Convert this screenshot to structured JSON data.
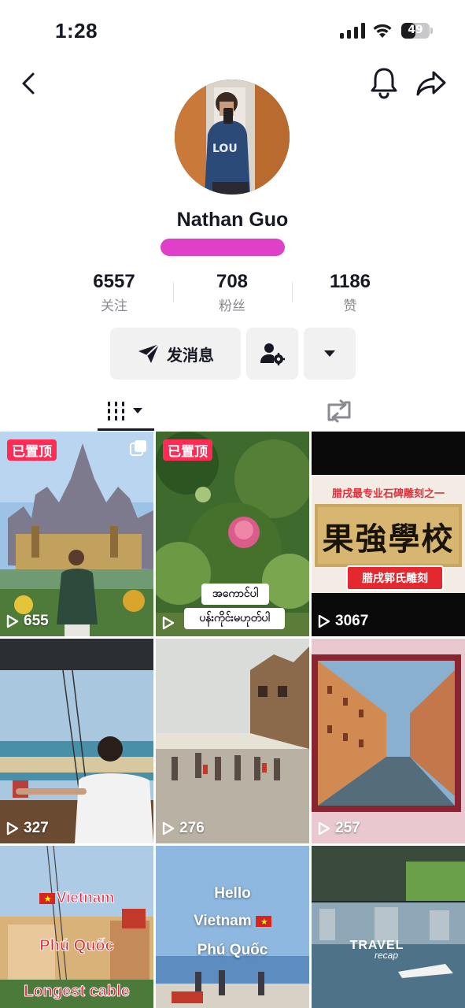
{
  "status_bar": {
    "time": "1:28",
    "battery_level": "49",
    "icons": [
      "signal-icon",
      "wifi-icon",
      "battery-icon"
    ]
  },
  "nav": {
    "icons": [
      "back-icon",
      "bell-icon",
      "share-icon"
    ]
  },
  "profile": {
    "name": "Nathan Guo",
    "stats": [
      {
        "value": "6557",
        "label": "关注"
      },
      {
        "value": "708",
        "label": "粉丝"
      },
      {
        "value": "1186",
        "label": "赞"
      }
    ]
  },
  "actions": {
    "message_label": "发消息",
    "icons": [
      "send-icon",
      "add-friend-settings-icon",
      "caret-down-icon"
    ]
  },
  "tabs": {
    "icons": [
      "videos-grid-icon",
      "repost-icon"
    ]
  },
  "colors": {
    "accent": "#fe2c55",
    "text": "#161823",
    "muted": "#8a8b91",
    "button_bg": "#f1f1f2",
    "redaction": "#e040c8"
  },
  "videos": [
    {
      "views": "655",
      "pinned_label": "已置顶"
    },
    {
      "views": "",
      "pinned_label": "已置顶",
      "caption_line1": "အကောင်ပါ",
      "caption_line2": "ပန်းကိုင်းမဟုတ်ပါ"
    },
    {
      "views": "3067",
      "banner_top": "腊戌最专业石碑雕刻之一",
      "sign_text": "果強學校",
      "banner_bottom": "腊戌郭氏雕刻"
    },
    {
      "views": "327"
    },
    {
      "views": "276"
    },
    {
      "views": "257"
    },
    {
      "views": "",
      "line1": "Vietnam",
      "line2": "Phú Quốc",
      "line3": "Longest cable"
    },
    {
      "views": "",
      "line1": "Hello",
      "line2": "Vietnam",
      "line3": "Phú Quốc"
    },
    {
      "views": "",
      "logo_text": "TRAVEL",
      "logo_sub": "recap"
    }
  ]
}
